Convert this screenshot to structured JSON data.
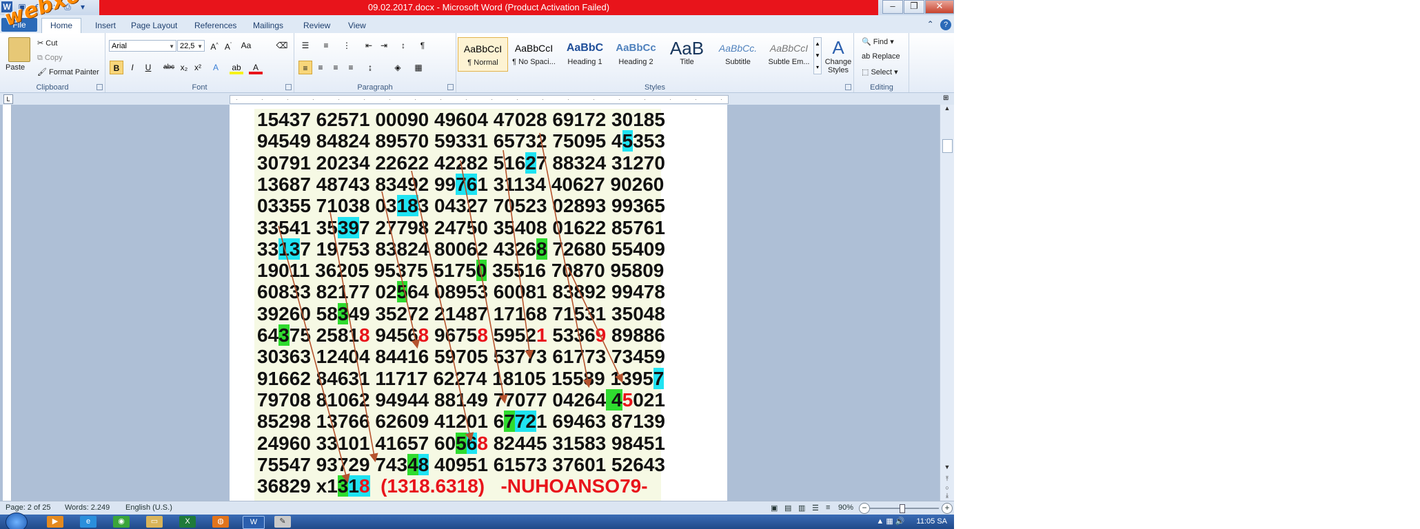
{
  "window": {
    "title": "09.02.2017.docx  -  Microsoft Word (Product Activation Failed)",
    "controls": [
      "–",
      "❐",
      "✕"
    ]
  },
  "watermark": "webxoso.net",
  "tabs": [
    "File",
    "Home",
    "Insert",
    "Page Layout",
    "References",
    "Mailings",
    "Review",
    "View"
  ],
  "active_tab": "Home",
  "ribbon": {
    "clipboard": {
      "label": "Clipboard",
      "paste": "Paste",
      "cut": "Cut",
      "copy": "Copy",
      "format_painter": "Format Painter"
    },
    "font": {
      "label": "Font",
      "font_name": "Arial",
      "font_size": "22,5"
    },
    "paragraph": {
      "label": "Paragraph"
    },
    "styles": {
      "label": "Styles",
      "items": [
        {
          "preview": "AaBbCcI",
          "name": "¶ Normal"
        },
        {
          "preview": "AaBbCcI",
          "name": "¶ No Spaci..."
        },
        {
          "preview": "AaBbC",
          "name": "Heading 1"
        },
        {
          "preview": "AaBbCc",
          "name": "Heading 2"
        },
        {
          "preview": "AaB",
          "name": "Title"
        },
        {
          "preview": "AaBbCc.",
          "name": "Subtitle"
        },
        {
          "preview": "AaBbCcI",
          "name": "Subtle Em..."
        }
      ],
      "change_styles": "Change Styles"
    },
    "editing": {
      "label": "Editing",
      "find": "Find",
      "replace": "Replace",
      "select": "Select"
    }
  },
  "document": {
    "rows": [
      "15437 62571 00090 49604 47028 69172 30185",
      "94549 84824 89570 59331 65732 75095 45353",
      "30791 20234 22622 42282 51627 88324 31270",
      "13687 48743 83492 99761 31134 40627 90260",
      "03355 71038 03183 04327 70523 02893 99365",
      "33541 35397 27798 24750 35408 01622 85761",
      "33137 19753 83824 80062 43268 72680 55409",
      "19011 36205 95375 51750 35516 70870 95809",
      "60833 82177 02564 08953 60081 83892 99478",
      "39260 58349 35272 21487 17168 71531 35048",
      "64375 25818 94568 96758 59521 53369 89886",
      "30363 12404 84416 59705 53773 61773 73459",
      "91662 84631 11717 62274 18105 15589 13957",
      "79708 81062 94944 88149 77077 04264 45021",
      "85298 13766 62609 41201 67721 69463 87139",
      "24960 33101 41657 60568 82445 31583 98451",
      "75547 93729 74348 40951 61573 37601 52643"
    ],
    "last_line_prefix": "36829 x1",
    "last_line_code": "318",
    "last_line_note": "(1318.6318)",
    "last_line_author": "-NUHOANSO79-",
    "highlight_colors": {
      "cyan": "#1fe3f2",
      "green": "#2fdb2f",
      "red": "#e8141b"
    }
  },
  "status": {
    "page": "Page: 2 of 25",
    "words": "Words: 2.249",
    "language": "English (U.S.)",
    "zoom": "90%"
  },
  "taskbar": {
    "time": "11:05 SA"
  }
}
